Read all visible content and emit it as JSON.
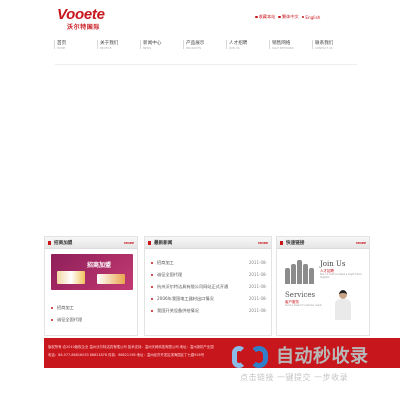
{
  "header": {
    "logo_main": "Vooete",
    "logo_sub": "沃尔特国际",
    "toplinks": [
      "收藏本站",
      "繁体中文",
      "English"
    ]
  },
  "nav": [
    {
      "cn": "首页",
      "en": "HOME"
    },
    {
      "cn": "关于我们",
      "en": "PROFILE"
    },
    {
      "cn": "新闻中心",
      "en": "NEWS"
    },
    {
      "cn": "产品展示",
      "en": "PRODUCTS"
    },
    {
      "cn": "人才招聘",
      "en": "JOIN US"
    },
    {
      "cn": "销售网络",
      "en": "SALE NETWORK"
    },
    {
      "cn": "联系我们",
      "en": "CONTACT US"
    }
  ],
  "panels": {
    "join": {
      "title": "招商加盟",
      "more": "MORE",
      "banner_text": "招商加盟",
      "items": [
        "招商加工",
        "诚征全国代理"
      ]
    },
    "news": {
      "title": "最新新闻",
      "more": "MORE",
      "items": [
        {
          "text": "招商加工",
          "date": "2011-08-"
        },
        {
          "text": "诚征全国代理",
          "date": "2011-08-"
        },
        {
          "text": "杭州沃尔特洁具有限公司网站正式开通",
          "date": "2011-08-"
        },
        {
          "text": "2006年我国电工器材出口情况",
          "date": "2011-08-"
        },
        {
          "text": "我国开关设备供给情况",
          "date": "2011-08-"
        }
      ]
    },
    "links": {
      "title": "快速链接",
      "more": "MORE",
      "join_title": "Join Us",
      "join_sub": "人才招聘",
      "join_desc": "Rely on Youth to Shape a bright future together",
      "services_title": "Services",
      "services_sub": "客户服务",
      "services_desc": "Service ahead of customer needs"
    }
  },
  "footer": {
    "line1": "版权所有:合2010版权企业 温州沃尔特洁具有限公司  技术支持：温州天网科技有限公司  地址：温州浙杭产业园",
    "line2": "电话：86-577-86816033 86821878 传真：86821198 地址：温州经济开发区滨海园区丁七路916号"
  },
  "watermark": {
    "brand": "自动秒收录",
    "tagline": "点击链接 一键提交 一步收录"
  }
}
